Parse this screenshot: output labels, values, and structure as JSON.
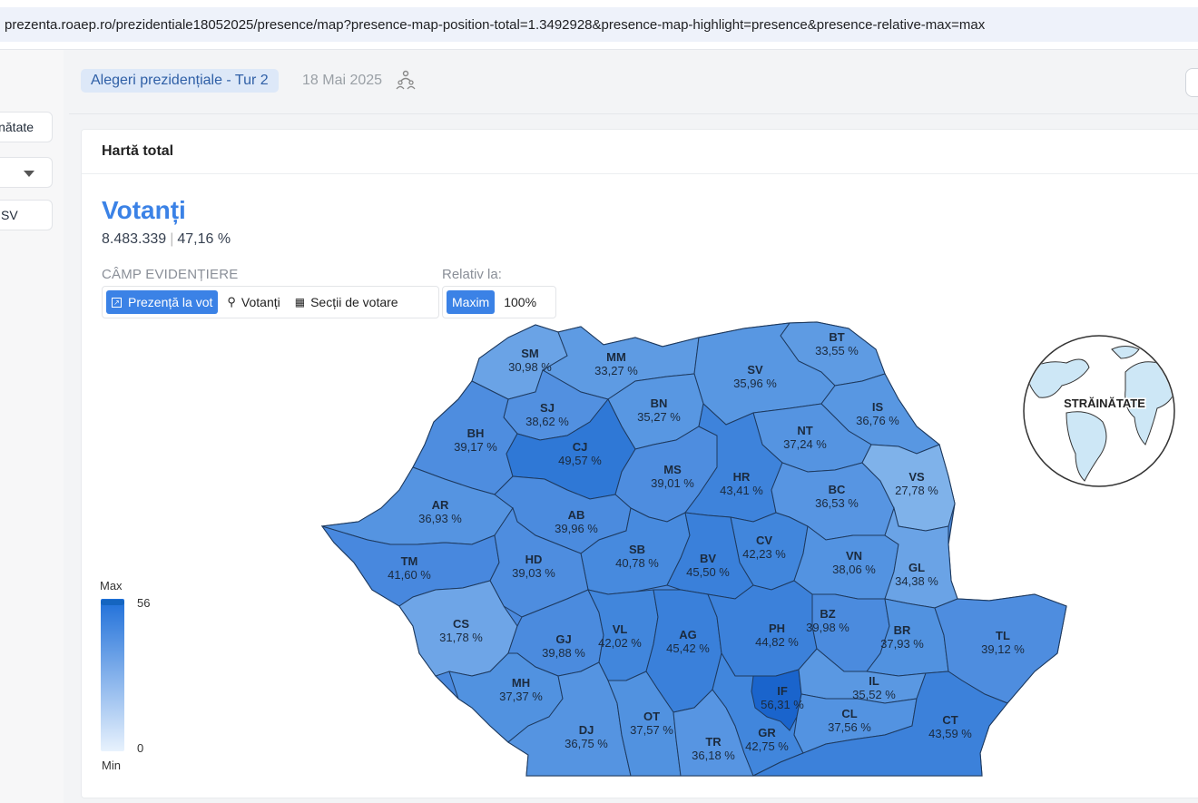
{
  "url": "prezenta.roaep.ro/prezidentiale18052025/presence/map?presence-map-position-total=1.3492928&presence-map-highlight=presence&presence-relative-max=max",
  "left_panel": {
    "btn_abroad": "inătate",
    "select_value": "",
    "btn_county": "SV"
  },
  "header": {
    "election_label": "Alegeri prezidențiale - Tur 2",
    "date": "18 Mai 2025"
  },
  "card": {
    "title": "Hartă total",
    "metric_title": "Votanți",
    "metric_count": "8.483.339",
    "metric_percent": "47,16 %",
    "field_label": "CÂMP EVIDENȚIERE",
    "relative_label": "Relativ la:",
    "field_options": [
      "Prezență la vot",
      "Votanți",
      "Secții de votare"
    ],
    "relative_options": [
      "Maxim",
      "100%"
    ]
  },
  "legend": {
    "max_label": "Max",
    "min_label": "Min",
    "max_value": "56",
    "min_value": "0"
  },
  "abroad_label": "STRĂINĂTATE",
  "colors": {
    "accent": "#3b82e6",
    "county_border": "#1e3a5f"
  },
  "counties": [
    {
      "code": "SM",
      "value": "30,98 %"
    },
    {
      "code": "MM",
      "value": "33,27 %"
    },
    {
      "code": "BT",
      "value": "33,55 %"
    },
    {
      "code": "SV",
      "value": "35,96 %"
    },
    {
      "code": "SJ",
      "value": "38,62 %"
    },
    {
      "code": "BN",
      "value": "35,27 %"
    },
    {
      "code": "IS",
      "value": "36,76 %"
    },
    {
      "code": "BH",
      "value": "39,17 %"
    },
    {
      "code": "CJ",
      "value": "49,57 %"
    },
    {
      "code": "NT",
      "value": "37,24 %"
    },
    {
      "code": "MS",
      "value": "39,01 %"
    },
    {
      "code": "HR",
      "value": "43,41 %"
    },
    {
      "code": "BC",
      "value": "36,53 %"
    },
    {
      "code": "VS",
      "value": "27,78 %"
    },
    {
      "code": "AR",
      "value": "36,93 %"
    },
    {
      "code": "AB",
      "value": "39,96 %"
    },
    {
      "code": "CV",
      "value": "42,23 %"
    },
    {
      "code": "SB",
      "value": "40,78 %"
    },
    {
      "code": "BV",
      "value": "45,50 %"
    },
    {
      "code": "VN",
      "value": "38,06 %"
    },
    {
      "code": "GL",
      "value": "34,38 %"
    },
    {
      "code": "TM",
      "value": "41,60 %"
    },
    {
      "code": "HD",
      "value": "39,03 %"
    },
    {
      "code": "CS",
      "value": "31,78 %"
    },
    {
      "code": "GJ",
      "value": "39,88 %"
    },
    {
      "code": "VL",
      "value": "42,02 %"
    },
    {
      "code": "AG",
      "value": "45,42 %"
    },
    {
      "code": "PH",
      "value": "44,82 %"
    },
    {
      "code": "BZ",
      "value": "39,98 %"
    },
    {
      "code": "BR",
      "value": "37,93 %"
    },
    {
      "code": "TL",
      "value": "39,12 %"
    },
    {
      "code": "MH",
      "value": "37,37 %"
    },
    {
      "code": "IF",
      "value": "56,31 %"
    },
    {
      "code": "IL",
      "value": "35,52 %"
    },
    {
      "code": "DJ",
      "value": "36,75 %"
    },
    {
      "code": "OT",
      "value": "37,57 %"
    },
    {
      "code": "TR",
      "value": "36,18 %"
    },
    {
      "code": "GR",
      "value": "42,75 %"
    },
    {
      "code": "CL",
      "value": "37,56 %"
    },
    {
      "code": "CT",
      "value": "43,59 %"
    }
  ]
}
